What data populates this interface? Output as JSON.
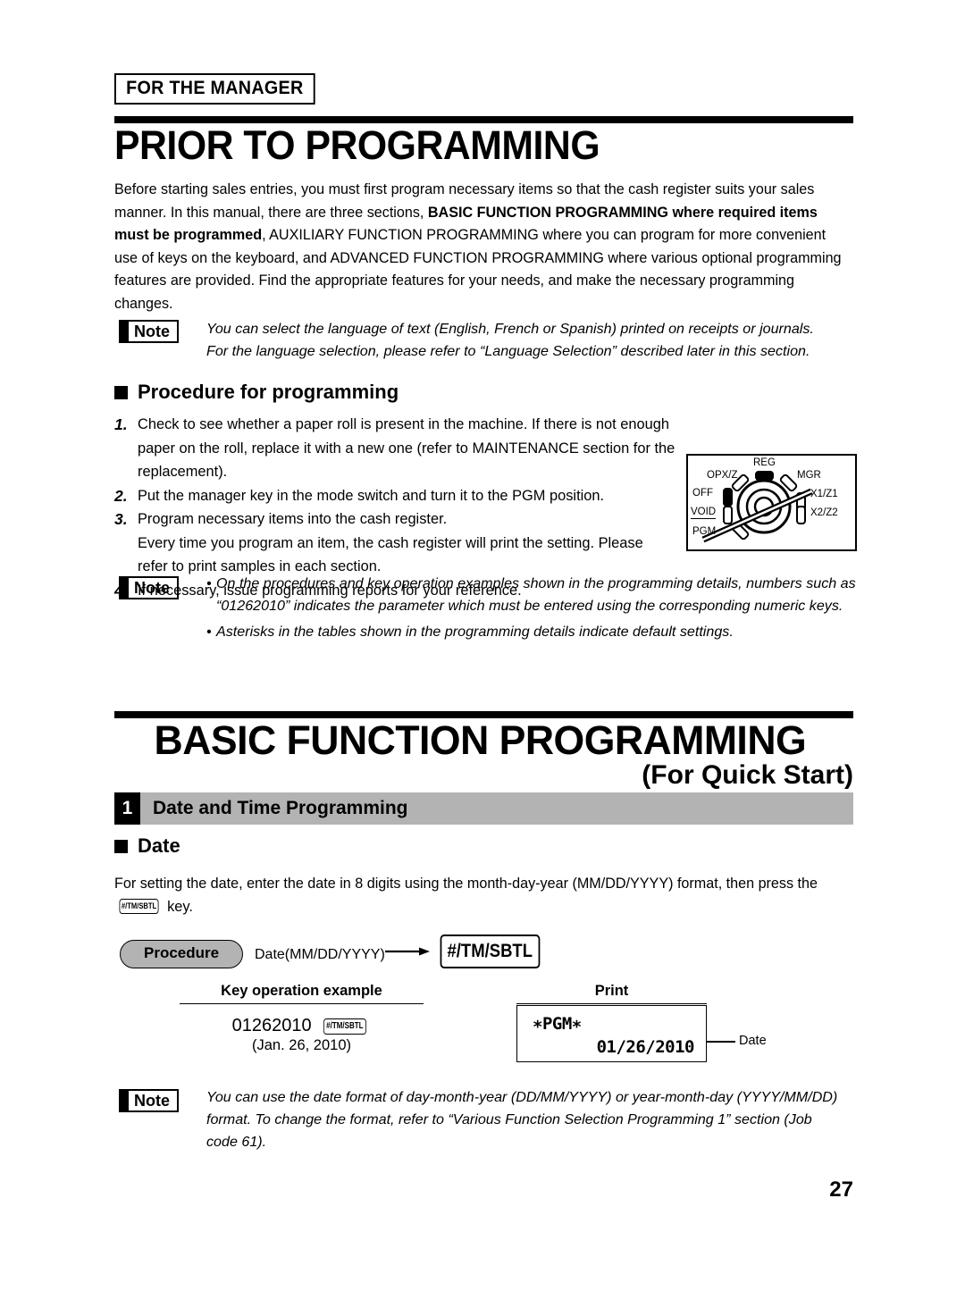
{
  "header": {
    "manager_tag": "FOR THE MANAGER"
  },
  "chapter1": {
    "title": "PRIOR TO PROGRAMMING",
    "intro_part1": "Before starting sales entries, you must first program necessary items so that the cash register suits your sales manner.  In this manual, there are three sections, ",
    "intro_bold1": "BASIC FUNCTION PROGRAMMING where required items must be programmed",
    "intro_part2": ", AUXILIARY FUNCTION PROGRAMMING where you can program for more convenient use of keys on the keyboard, and ADVANCED FUNCTION PROGRAMMING where various optional programming features are provided.  Find the appropriate features for your needs, and make the necessary programming changes."
  },
  "note1": {
    "label": "Note",
    "line1": "You can select the language of text (English, French or Spanish) printed on receipts or journals.",
    "line2": "For the language selection, please refer to “Language Selection” described later in this section."
  },
  "procedure_section": {
    "heading": "Procedure for programming",
    "items": [
      {
        "num": "1.",
        "text": "Check to see whether a paper roll is present in the machine.  If there is not enough paper on the roll, replace it with a new one (refer to MAINTENANCE section for the replacement)."
      },
      {
        "num": "2.",
        "text": "Put the manager key in the mode switch and turn it to the PGM position."
      },
      {
        "num": "3.",
        "text": "Program necessary items into the cash register."
      },
      {
        "num": "4.",
        "text": "If necessary, issue programming reports for your reference."
      }
    ],
    "item3_cont1": "Every time you program an item, the cash register will print the setting.  Please",
    "item3_cont2": "refer to print samples in each section."
  },
  "mode_switch": {
    "name": "mode-switch-dial",
    "positions": [
      {
        "key": "reg",
        "label": "REG"
      },
      {
        "key": "opxz",
        "label": "OPX/Z"
      },
      {
        "key": "mgr",
        "label": "MGR"
      },
      {
        "key": "off",
        "label": "OFF"
      },
      {
        "key": "x1z1",
        "label": "X1/Z1"
      },
      {
        "key": "void",
        "label": "VOID"
      },
      {
        "key": "x2z2",
        "label": "X2/Z2"
      },
      {
        "key": "pgm",
        "label": "PGM"
      }
    ],
    "selected": "PGM"
  },
  "note2": {
    "label": "Note",
    "bullet1": "On the procedures and key operation examples shown in the programming details, numbers such as “01262010” indicates the parameter which must be entered using the corresponding numeric keys.",
    "bullet2": "Asterisks in the tables shown in the programming details indicate default settings."
  },
  "chapter2": {
    "title": "BASIC FUNCTION PROGRAMMING",
    "subtitle": "(For Quick Start)"
  },
  "section1": {
    "number": "1",
    "title": "Date and Time Programming",
    "date_heading": "Date",
    "date_intro_a": "For setting the date, enter the date in 8 digits using the month-day-year (MM/DD/YYYY) format, then press the",
    "date_key": "#/TM/SBTL",
    "date_intro_b": "key."
  },
  "procedure_flow": {
    "pill_label": "Procedure",
    "input_label": "Date(MM/DD/YYYY)",
    "key_label": "#/TM/SBTL"
  },
  "example_table": {
    "col1_header": "Key operation example",
    "col2_header": "Print",
    "entry_value": "01262010",
    "entry_key": "#/TM/SBTL",
    "entry_note": "(Jan. 26, 2010)",
    "print_mode": "∗PGM∗",
    "print_date": "01/26/2010",
    "callout": "Date"
  },
  "note3": {
    "label": "Note",
    "line1": "You can use the date format of day-month-year (DD/MM/YYYY) or year-month-day (YYYY/MM/DD)",
    "line2": "format.  To change the format, refer to “Various Function Selection Programming 1” section (Job",
    "line3": "code 61)."
  },
  "footer": {
    "page_number": "27"
  }
}
